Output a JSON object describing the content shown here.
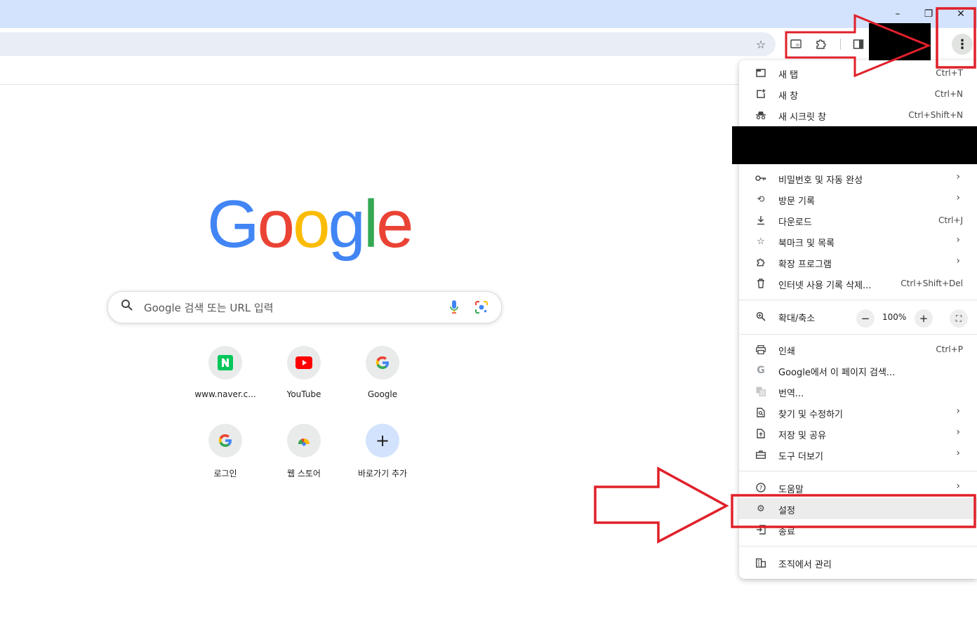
{
  "window": {
    "minimize_label": "–",
    "restore_label": "❐",
    "close_label": "✕"
  },
  "toolbar": {
    "bookmark_icon": "star-icon",
    "cast_icon": "cast-icon",
    "extensions_icon": "puzzle-icon",
    "sidepanel_icon": "side-panel-icon",
    "menu_label": "⋮"
  },
  "ntp": {
    "logo_letters": [
      "G",
      "o",
      "o",
      "g",
      "l",
      "e"
    ],
    "logo_colors": [
      "#4285f4",
      "#ea4335",
      "#fbbc05",
      "#4285f4",
      "#34a853",
      "#ea4335"
    ],
    "search_placeholder": "Google 검색 또는 URL 입력",
    "shortcuts": [
      {
        "label": "www.naver.c...",
        "icon": "naver-icon"
      },
      {
        "label": "YouTube",
        "icon": "youtube-icon"
      },
      {
        "label": "Google",
        "icon": "google-g-icon"
      },
      {
        "label": "로그인",
        "icon": "google-g-icon"
      },
      {
        "label": "웹 스토어",
        "icon": "chrome-web-store-icon"
      },
      {
        "label": "바로가기 추가",
        "icon": "plus-icon"
      }
    ]
  },
  "menu": {
    "items": [
      {
        "label": "새 탭",
        "shortcut": "Ctrl+T"
      },
      {
        "label": "새 창",
        "shortcut": "Ctrl+N"
      },
      {
        "label": "새 시크릿 창",
        "shortcut": "Ctrl+Shift+N"
      },
      {
        "label": "비밀번호 및 자동 완성",
        "chevron": "›"
      },
      {
        "label": "방문 기록",
        "chevron": "›"
      },
      {
        "label": "다운로드",
        "shortcut": "Ctrl+J"
      },
      {
        "label": "북마크 및 목록",
        "chevron": "›"
      },
      {
        "label": "확장 프로그램",
        "chevron": "›"
      },
      {
        "label": "인터넷 사용 기록 삭제...",
        "shortcut": "Ctrl+Shift+Del"
      },
      {
        "label": "확대/축소"
      },
      {
        "label": "인쇄",
        "shortcut": "Ctrl+P"
      },
      {
        "label": "Google에서 이 페이지 검색..."
      },
      {
        "label": "번역..."
      },
      {
        "label": "찾기 및 수정하기",
        "chevron": "›"
      },
      {
        "label": "저장 및 공유",
        "chevron": "›"
      },
      {
        "label": "도구 더보기",
        "chevron": "›"
      },
      {
        "label": "도움말",
        "chevron": "›"
      },
      {
        "label": "설정"
      },
      {
        "label": "종료"
      },
      {
        "label": "조직에서 관리"
      }
    ],
    "zoom": {
      "minus": "−",
      "value": "100%",
      "plus": "+",
      "fullscreen": "⛶"
    }
  },
  "colors": {
    "titlebar": "#d3e3fd",
    "omnibox": "#e9eef6",
    "annotation_red": "#e0202a",
    "highlight_row": "#ececec"
  }
}
